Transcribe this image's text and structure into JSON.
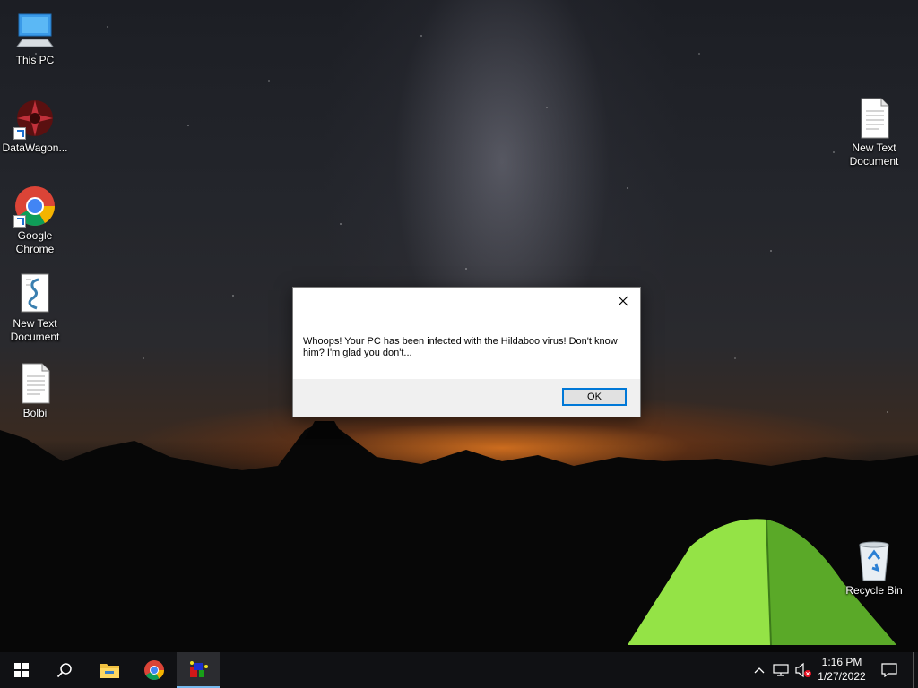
{
  "desktop_icons": [
    {
      "label": "This PC",
      "icon": "this-pc-icon"
    },
    {
      "label": "DataWagon...",
      "icon": "datawagon-icon",
      "shortcut": true
    },
    {
      "label": "Google Chrome",
      "icon": "chrome-icon",
      "shortcut": true
    },
    {
      "label": "New Text Document",
      "icon": "script-document-icon"
    },
    {
      "label": "Bolbi",
      "icon": "text-document-icon"
    },
    {
      "label": "New Text Document",
      "icon": "text-document-icon"
    },
    {
      "label": "Recycle Bin",
      "icon": "recycle-bin-icon"
    }
  ],
  "dialog": {
    "message": "Whoops! Your PC has been infected with the Hildaboo virus! Don't know him? I'm glad you don't...",
    "ok_label": "OK",
    "close_icon": "close-icon"
  },
  "taskbar": {
    "buttons": [
      "start-icon",
      "search-icon",
      "file-explorer-icon",
      "chrome-icon",
      "running-app-icon"
    ],
    "tray_icons": [
      "chevron-up-icon",
      "network-icon",
      "volume-muted-icon",
      "notification-icon"
    ],
    "time": "1:16 PM",
    "date": "1/27/2022"
  },
  "colors": {
    "accent": "#0078d7",
    "taskbar": "#101114",
    "dialog_footer": "#f0f0f0"
  }
}
